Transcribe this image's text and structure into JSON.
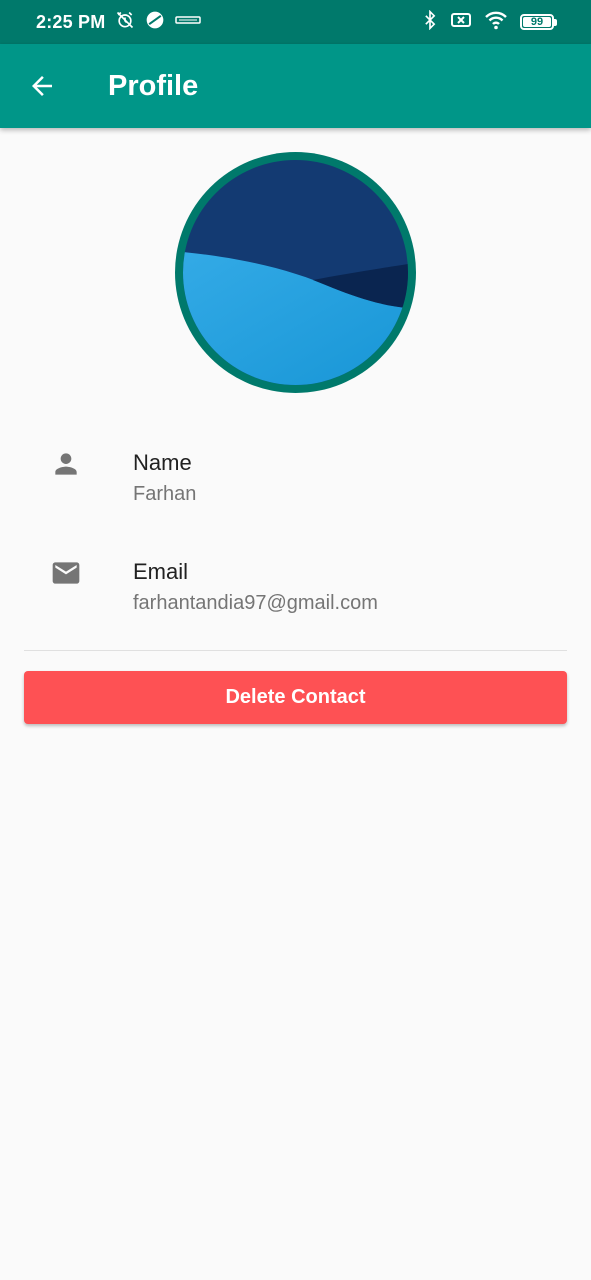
{
  "status_bar": {
    "time": "2:25 PM",
    "battery": "99",
    "battery_level": 0.99,
    "icons": [
      "alarm-off-icon",
      "app-circle-icon",
      "carrier-logo-icon",
      "bluetooth-icon",
      "sim-off-icon",
      "wifi-icon",
      "battery-icon"
    ]
  },
  "app_bar": {
    "title": "Profile",
    "back_icon": "arrow-back-icon",
    "color": "#009688"
  },
  "profile": {
    "avatar": "profile-avatar-image",
    "ring_color": "#00796b",
    "fields": [
      {
        "icon": "person-icon",
        "label": "Name",
        "value": "Farhan"
      },
      {
        "icon": "email-icon",
        "label": "Email",
        "value": "farhantandia97@gmail.com"
      }
    ]
  },
  "actions": {
    "delete_label": "Delete Contact",
    "delete_color": "#fe5154"
  }
}
